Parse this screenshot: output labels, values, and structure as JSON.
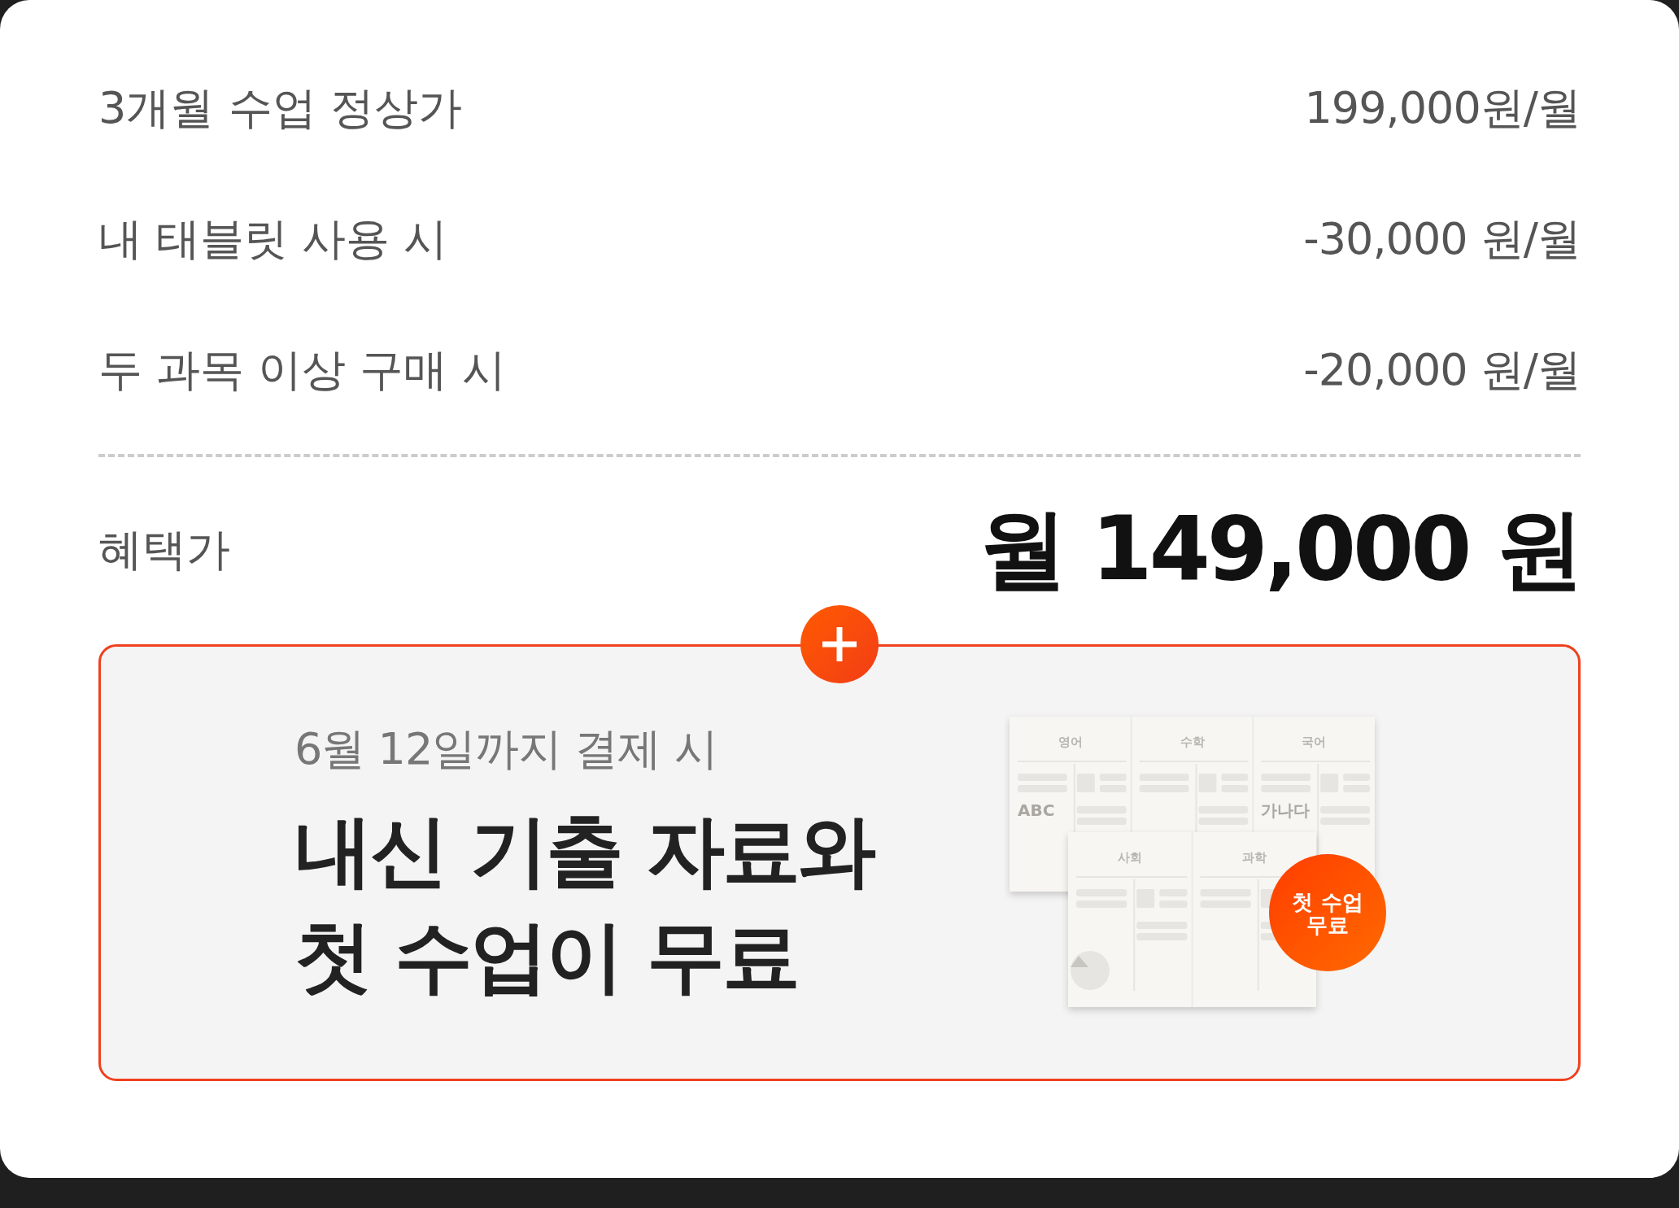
{
  "price_rows": [
    {
      "label": "3개월 수업 정상가",
      "value": "199,000원/월"
    },
    {
      "label": "내 태블릿 사용 시",
      "value": "-30,000 원/월"
    },
    {
      "label": "두 과목 이상 구매 시",
      "value": "-20,000 원/월"
    }
  ],
  "benefit": {
    "label": "혜택가",
    "value": "월 149,000 원"
  },
  "promo": {
    "subtitle": "6월 12일까지 결제 시",
    "headline": [
      "내신 기출 자료와",
      "첫 수업이 무료"
    ],
    "illustration": {
      "back_sheets": [
        {
          "label": "영어",
          "mark": "ABC"
        },
        {
          "label": "수학"
        },
        {
          "label": "국어",
          "mark": "가나다"
        }
      ],
      "front_sheets": [
        {
          "label": "사회"
        },
        {
          "label": "과학"
        }
      ],
      "badge": [
        "첫 수업",
        "무료"
      ]
    }
  }
}
